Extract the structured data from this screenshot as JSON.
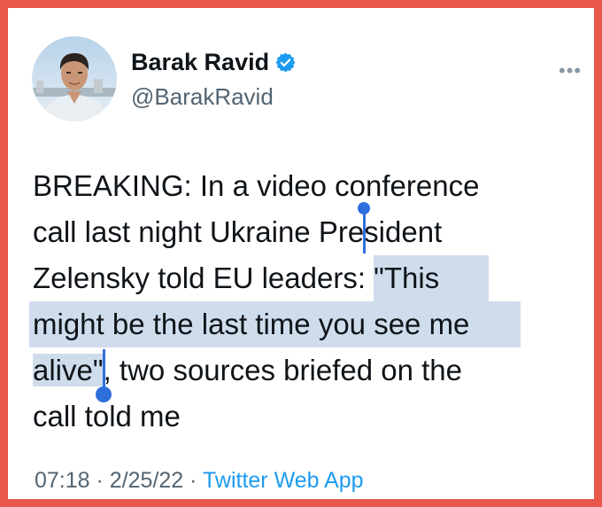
{
  "author": {
    "name": "Barak Ravid",
    "handle": "@BarakRavid",
    "verified": true
  },
  "more_button_icon": "more-horizontal-icon",
  "tweet": {
    "lines": [
      {
        "text": "BREAKING: In a video conference"
      },
      {
        "pre": "call last night Ukraine Pre",
        "post": "sident"
      },
      {
        "pre": "Zelensky told EU leaders: ",
        "highlighted": "\"This"
      },
      {
        "highlighted": "might be the last time you see me"
      },
      {
        "highlighted": "alive\"",
        "post": ", two sources briefed on the"
      },
      {
        "text": "call told me"
      }
    ]
  },
  "meta": {
    "time": "07:18",
    "separator": "·",
    "date": "2/25/22",
    "source": "Twitter Web App"
  },
  "colors": {
    "frame": "#e8584b",
    "selection": "#cfdcec",
    "selection_handle": "#2f6fdc",
    "link": "#1d9bf0",
    "verified_badge": "#1d9bf0"
  }
}
